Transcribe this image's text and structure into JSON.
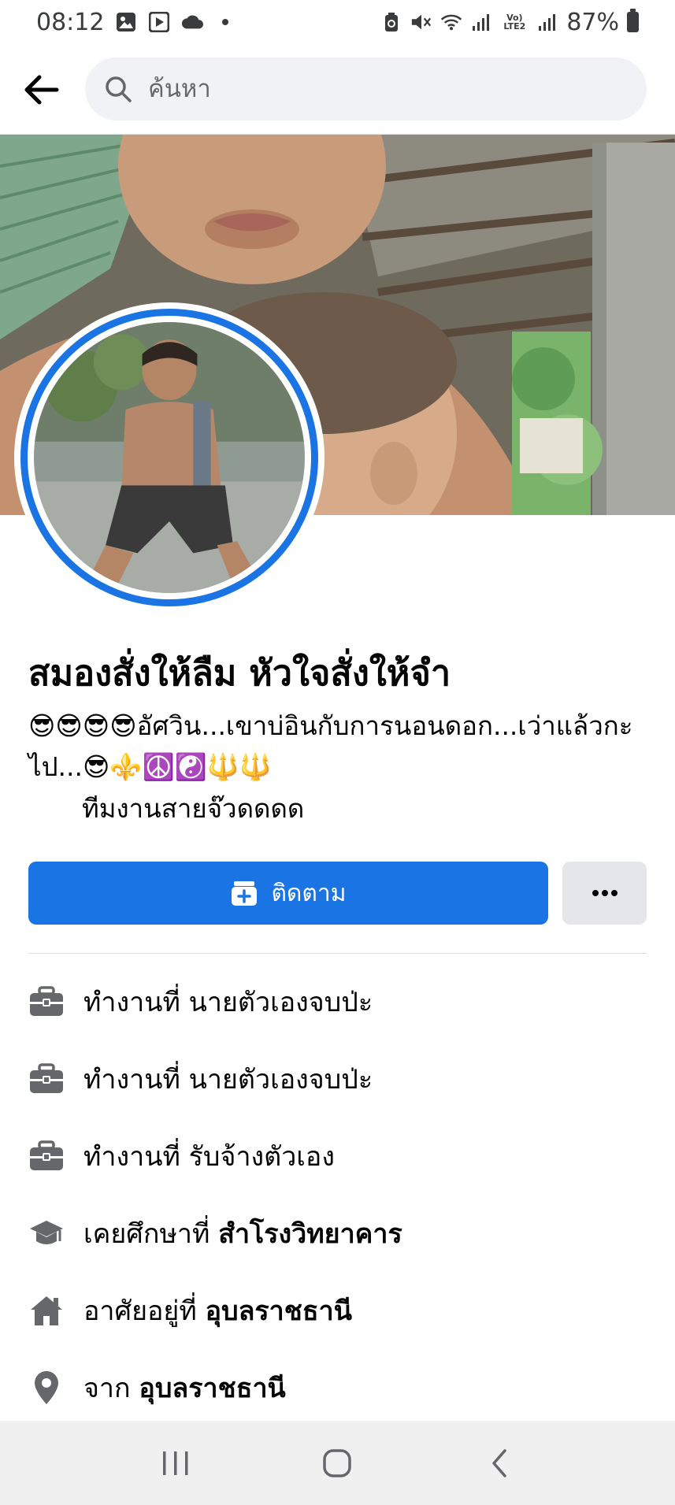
{
  "status_bar": {
    "time": "08:12",
    "battery": "87%",
    "lte": "Vo) LTE2"
  },
  "search": {
    "placeholder": "ค้นหา"
  },
  "profile": {
    "name": "สมองสั่งให้ลืม หัวใจสั่งให้จำ",
    "bio": "😎😎😎😎อัศวิน...เขาบ่อินกับการนอนดอก...เว่าแล้วกะไป...😎⚜️☮️☯️🔱🔱",
    "bio_sub": "ทีมงานสายจ๊วดดดด"
  },
  "actions": {
    "follow_label": "ติดตาม",
    "more_label": "..."
  },
  "info": [
    {
      "icon": "briefcase-icon",
      "prefix": "ทำงานที่ ",
      "value": "นายตัวเองจบป่ะ",
      "bold": false
    },
    {
      "icon": "briefcase-icon",
      "prefix": "ทำงานที่ ",
      "value": "นายตัวเองจบป่ะ",
      "bold": false
    },
    {
      "icon": "briefcase-icon",
      "prefix": "ทำงานที่ ",
      "value": "รับจ้างตัวเอง",
      "bold": false
    },
    {
      "icon": "graduation-cap-icon",
      "prefix": "เคยศึกษาที่ ",
      "value": "สำโรงวิทยาคาร",
      "bold": true
    },
    {
      "icon": "home-icon",
      "prefix": "อาศัยอยู่ที่ ",
      "value": "อุบลราชธานี",
      "bold": true
    },
    {
      "icon": "location-pin-icon",
      "prefix": "จาก ",
      "value": "อุบลราชธานี",
      "bold": true
    }
  ],
  "colors": {
    "accent": "#1b74e4",
    "secondary_button": "#e4e6eb",
    "search_bg": "#f0f2f5",
    "icon_gray": "#65676b"
  }
}
